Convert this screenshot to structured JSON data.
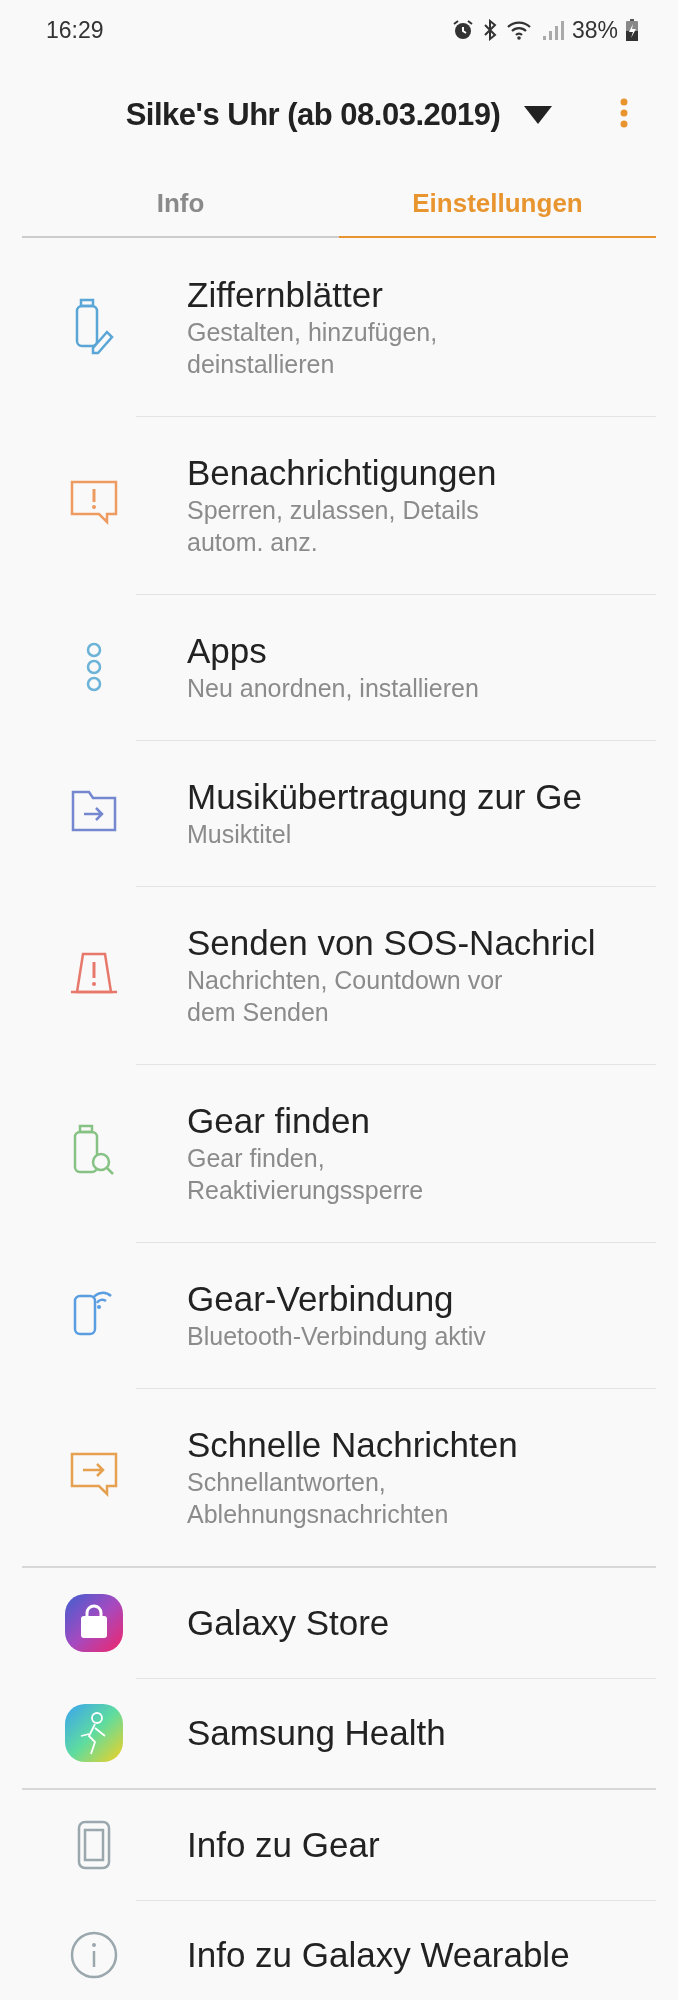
{
  "status_bar": {
    "time": "16:29",
    "battery": "38%"
  },
  "header": {
    "title": "Silke's Uhr (ab 08.03.2019)"
  },
  "tabs": [
    {
      "label": "Info",
      "selected": false
    },
    {
      "label": "Einstellungen",
      "selected": true
    }
  ],
  "sections": [
    {
      "items": [
        {
          "title": "Ziffernblätter",
          "subtitle": "Gestalten, hinzufügen, deinstallieren"
        },
        {
          "title": "Benachrichtigungen",
          "subtitle": "Sperren, zulassen, Details autom. anz."
        },
        {
          "title": "Apps",
          "subtitle": "Neu anordnen, installieren"
        },
        {
          "title": "Musikübertragung zur Ge",
          "subtitle": "Musiktitel"
        },
        {
          "title": "Senden von SOS-Nachricl",
          "subtitle": "Nachrichten, Countdown vor dem Senden"
        },
        {
          "title": "Gear finden",
          "subtitle": "Gear finden, Reaktivierungssperre"
        },
        {
          "title": "Gear-Verbindung",
          "subtitle": "Bluetooth-Verbindung aktiv"
        },
        {
          "title": "Schnelle Nachrichten",
          "subtitle": "Schnellantworten, Ablehnungsnachrichten"
        }
      ]
    },
    {
      "items": [
        {
          "title": "Galaxy Store"
        },
        {
          "title": "Samsung Health"
        }
      ]
    },
    {
      "items": [
        {
          "title": "Info zu Gear"
        },
        {
          "title": "Info zu Galaxy Wearable"
        }
      ]
    }
  ]
}
